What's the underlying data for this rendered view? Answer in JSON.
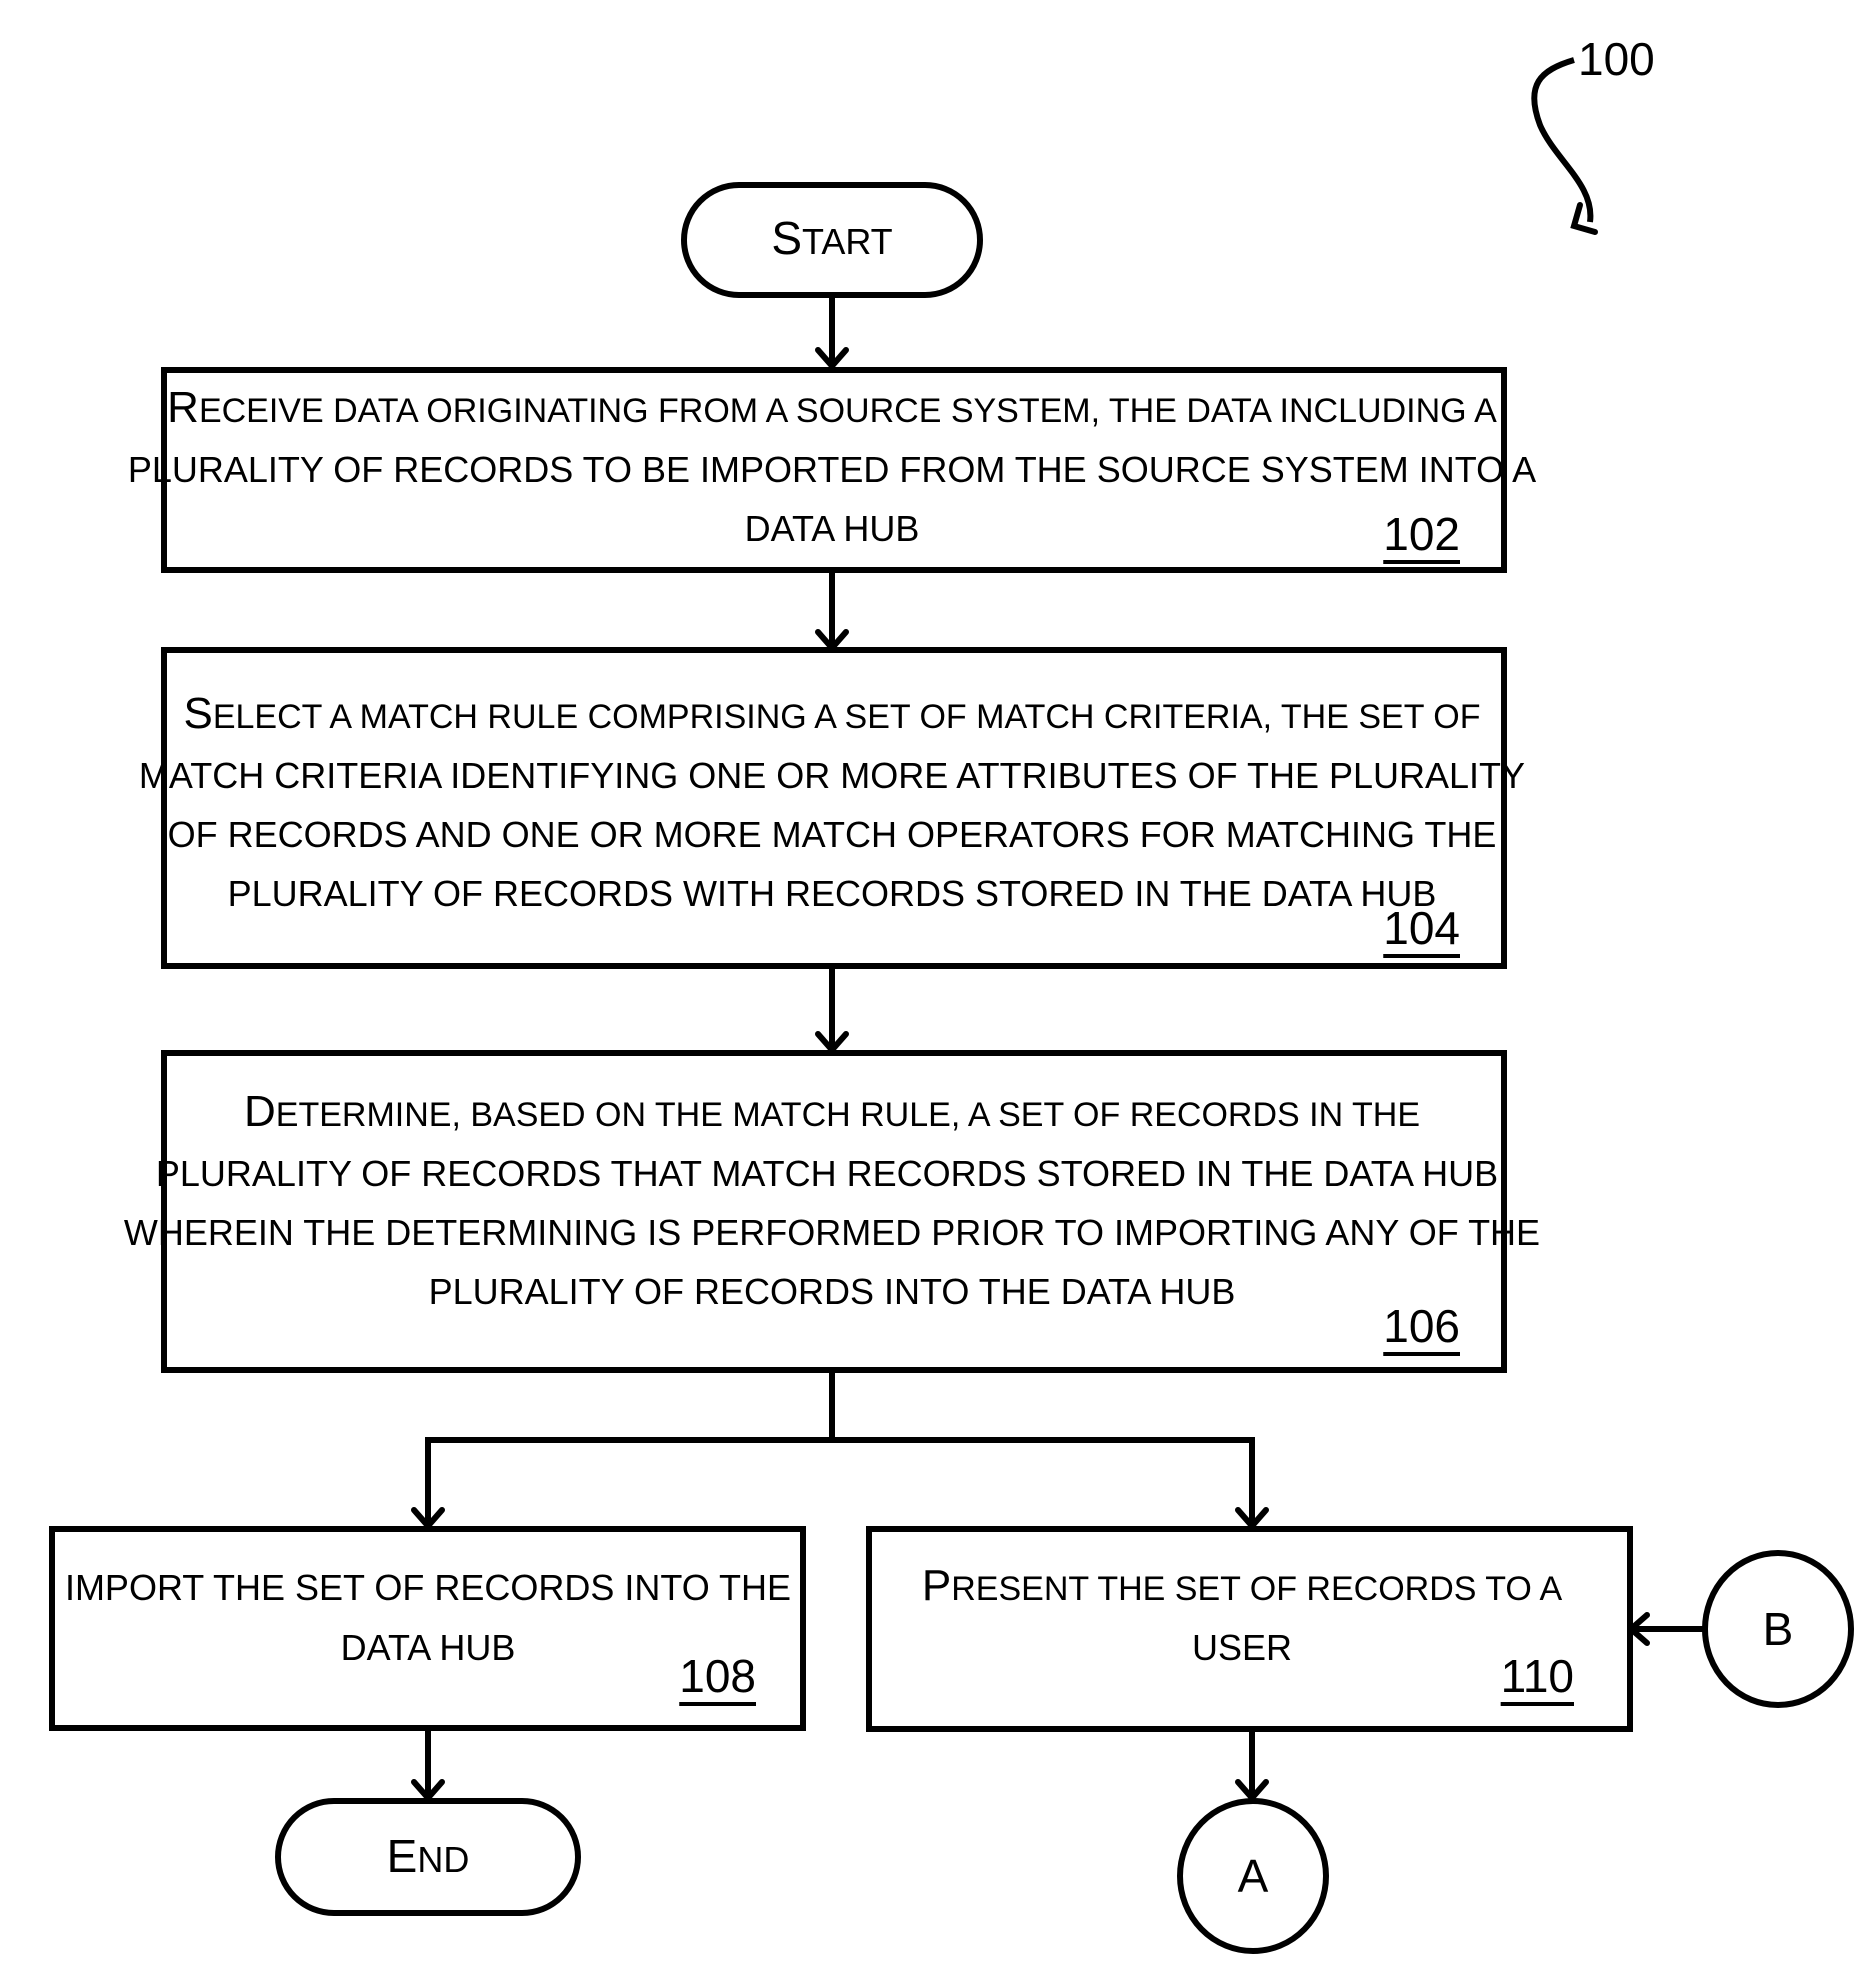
{
  "figure": {
    "reference_number": "100"
  },
  "nodes": {
    "start": {
      "label": "START",
      "type": "terminal"
    },
    "step_102": {
      "ref": "102",
      "lines": [
        "RECEIVE DATA ORIGINATING FROM A SOURCE SYSTEM, THE DATA INCLUDING A",
        "PLURALITY OF RECORDS TO BE IMPORTED FROM THE SOURCE SYSTEM INTO A",
        "DATA HUB"
      ]
    },
    "step_104": {
      "ref": "104",
      "lines": [
        "SELECT A MATCH RULE COMPRISING A SET OF MATCH CRITERIA, THE SET OF",
        "MATCH CRITERIA IDENTIFYING ONE OR MORE ATTRIBUTES OF THE PLURALITY",
        "OF RECORDS AND ONE OR MORE MATCH OPERATORS FOR MATCHING THE",
        "PLURALITY OF RECORDS WITH RECORDS STORED IN THE DATA HUB"
      ]
    },
    "step_106": {
      "ref": "106",
      "lines": [
        "DETERMINE, BASED ON THE MATCH RULE, A SET OF RECORDS IN THE",
        "PLURALITY OF RECORDS THAT MATCH RECORDS STORED IN THE DATA HUB,",
        "WHEREIN THE DETERMINING IS PERFORMED PRIOR TO IMPORTING ANY OF THE",
        "PLURALITY OF RECORDS INTO THE DATA HUB"
      ]
    },
    "step_108": {
      "ref": "108",
      "lines": [
        "IMPORT THE SET OF RECORDS INTO THE",
        "DATA HUB"
      ]
    },
    "step_110": {
      "ref": "110",
      "lines": [
        "PRESENT THE SET OF RECORDS TO A",
        "USER"
      ]
    },
    "end": {
      "label": "END",
      "type": "terminal"
    },
    "connector_a": {
      "label": "A",
      "type": "off-page-connector"
    },
    "connector_b": {
      "label": "B",
      "type": "off-page-connector"
    }
  },
  "edges": [
    {
      "from": "start",
      "to": "step_102"
    },
    {
      "from": "step_102",
      "to": "step_104"
    },
    {
      "from": "step_104",
      "to": "step_106"
    },
    {
      "from": "step_106",
      "to": "step_108"
    },
    {
      "from": "step_106",
      "to": "step_110"
    },
    {
      "from": "step_108",
      "to": "end"
    },
    {
      "from": "step_110",
      "to": "connector_a"
    },
    {
      "from": "connector_b",
      "to": "step_110"
    }
  ]
}
